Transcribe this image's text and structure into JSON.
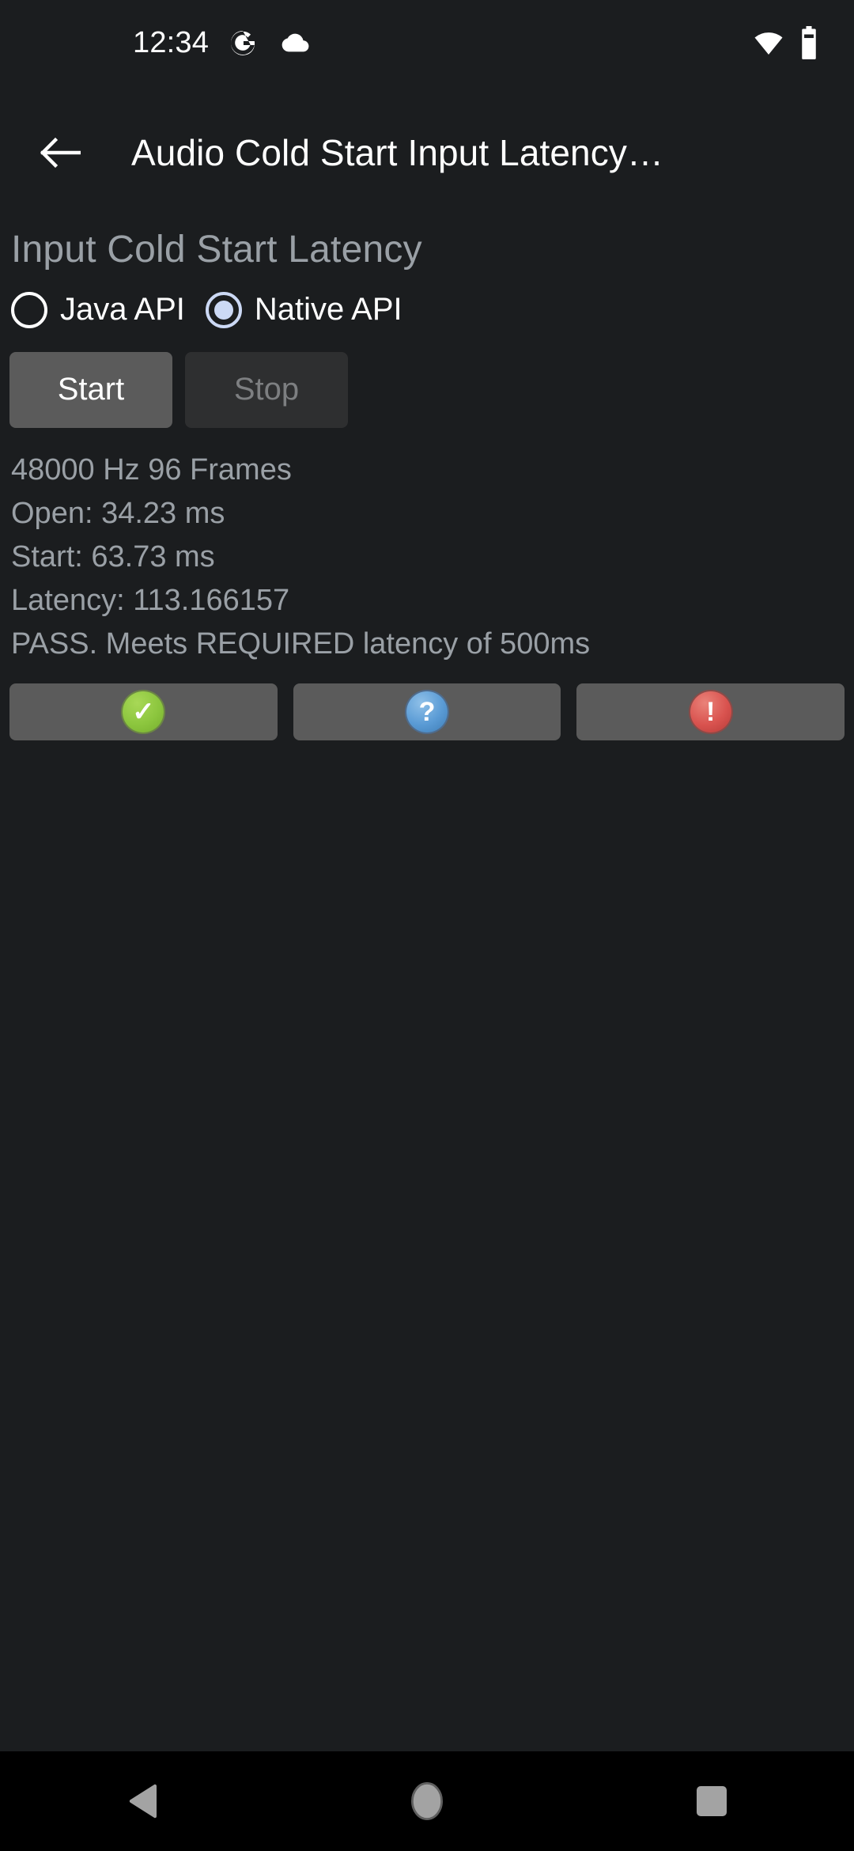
{
  "status_bar": {
    "clock": "12:34",
    "icons": [
      "google-g-icon",
      "cloud-icon",
      "wifi-icon",
      "battery-icon"
    ]
  },
  "app_bar": {
    "back_label": "back-arrow-icon",
    "title": "Audio Cold Start Input Latency…"
  },
  "main": {
    "heading": "Input Cold Start Latency",
    "api_options": [
      {
        "label": "Java API",
        "selected": false
      },
      {
        "label": "Native API",
        "selected": true
      }
    ],
    "controls": {
      "start_label": "Start",
      "start_enabled": true,
      "stop_label": "Stop",
      "stop_enabled": false
    },
    "results": [
      "48000 Hz 96 Frames",
      "Open: 34.23 ms",
      "Start: 63.73 ms",
      "Latency: 113.166157",
      "PASS. Meets REQUIRED latency of 500ms"
    ],
    "verdict_buttons": [
      {
        "name": "pass-button",
        "glyph": "✓",
        "color": "#8cc63e"
      },
      {
        "name": "info-button",
        "glyph": "?",
        "color": "#5a9bd5"
      },
      {
        "name": "fail-button",
        "glyph": "!",
        "color": "#d9534f"
      }
    ]
  },
  "nav_bar": {
    "back": "nav-back-icon",
    "home": "nav-home-icon",
    "recents": "nav-recents-icon"
  }
}
